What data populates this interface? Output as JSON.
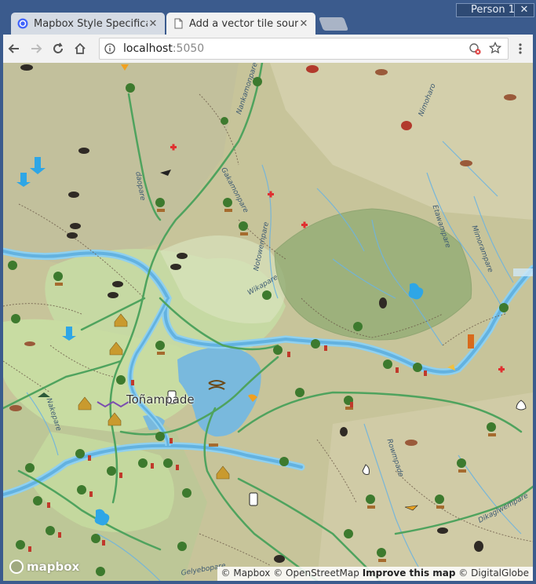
{
  "window": {
    "profile_label": "Person 1",
    "close_label": "✕"
  },
  "tabs": [
    {
      "title": "Mapbox Style Specification",
      "active": false,
      "icon": "mapbox-favicon-icon"
    },
    {
      "title": "Add a vector tile source",
      "active": true,
      "icon": "document-icon"
    }
  ],
  "toolbar": {
    "url_host": "localhost",
    "url_port": ":5050"
  },
  "map": {
    "place_label": "Toñampade",
    "road_labels": [
      "Nankamonpare",
      "Gakamonpare",
      "daopare",
      "Notowempare",
      "Wikapare",
      "Nimoharo",
      "Etawampare",
      "Mimorampare",
      "Nakepare",
      "Rowmpade",
      "Dikaglwempare",
      "Gelyebopare"
    ],
    "logo_text": "mapbox",
    "attribution": {
      "mapbox": "© Mapbox",
      "osm": "© OpenStreetMap",
      "improve": "Improve this map",
      "dg": "© DigitalGlobe"
    }
  }
}
